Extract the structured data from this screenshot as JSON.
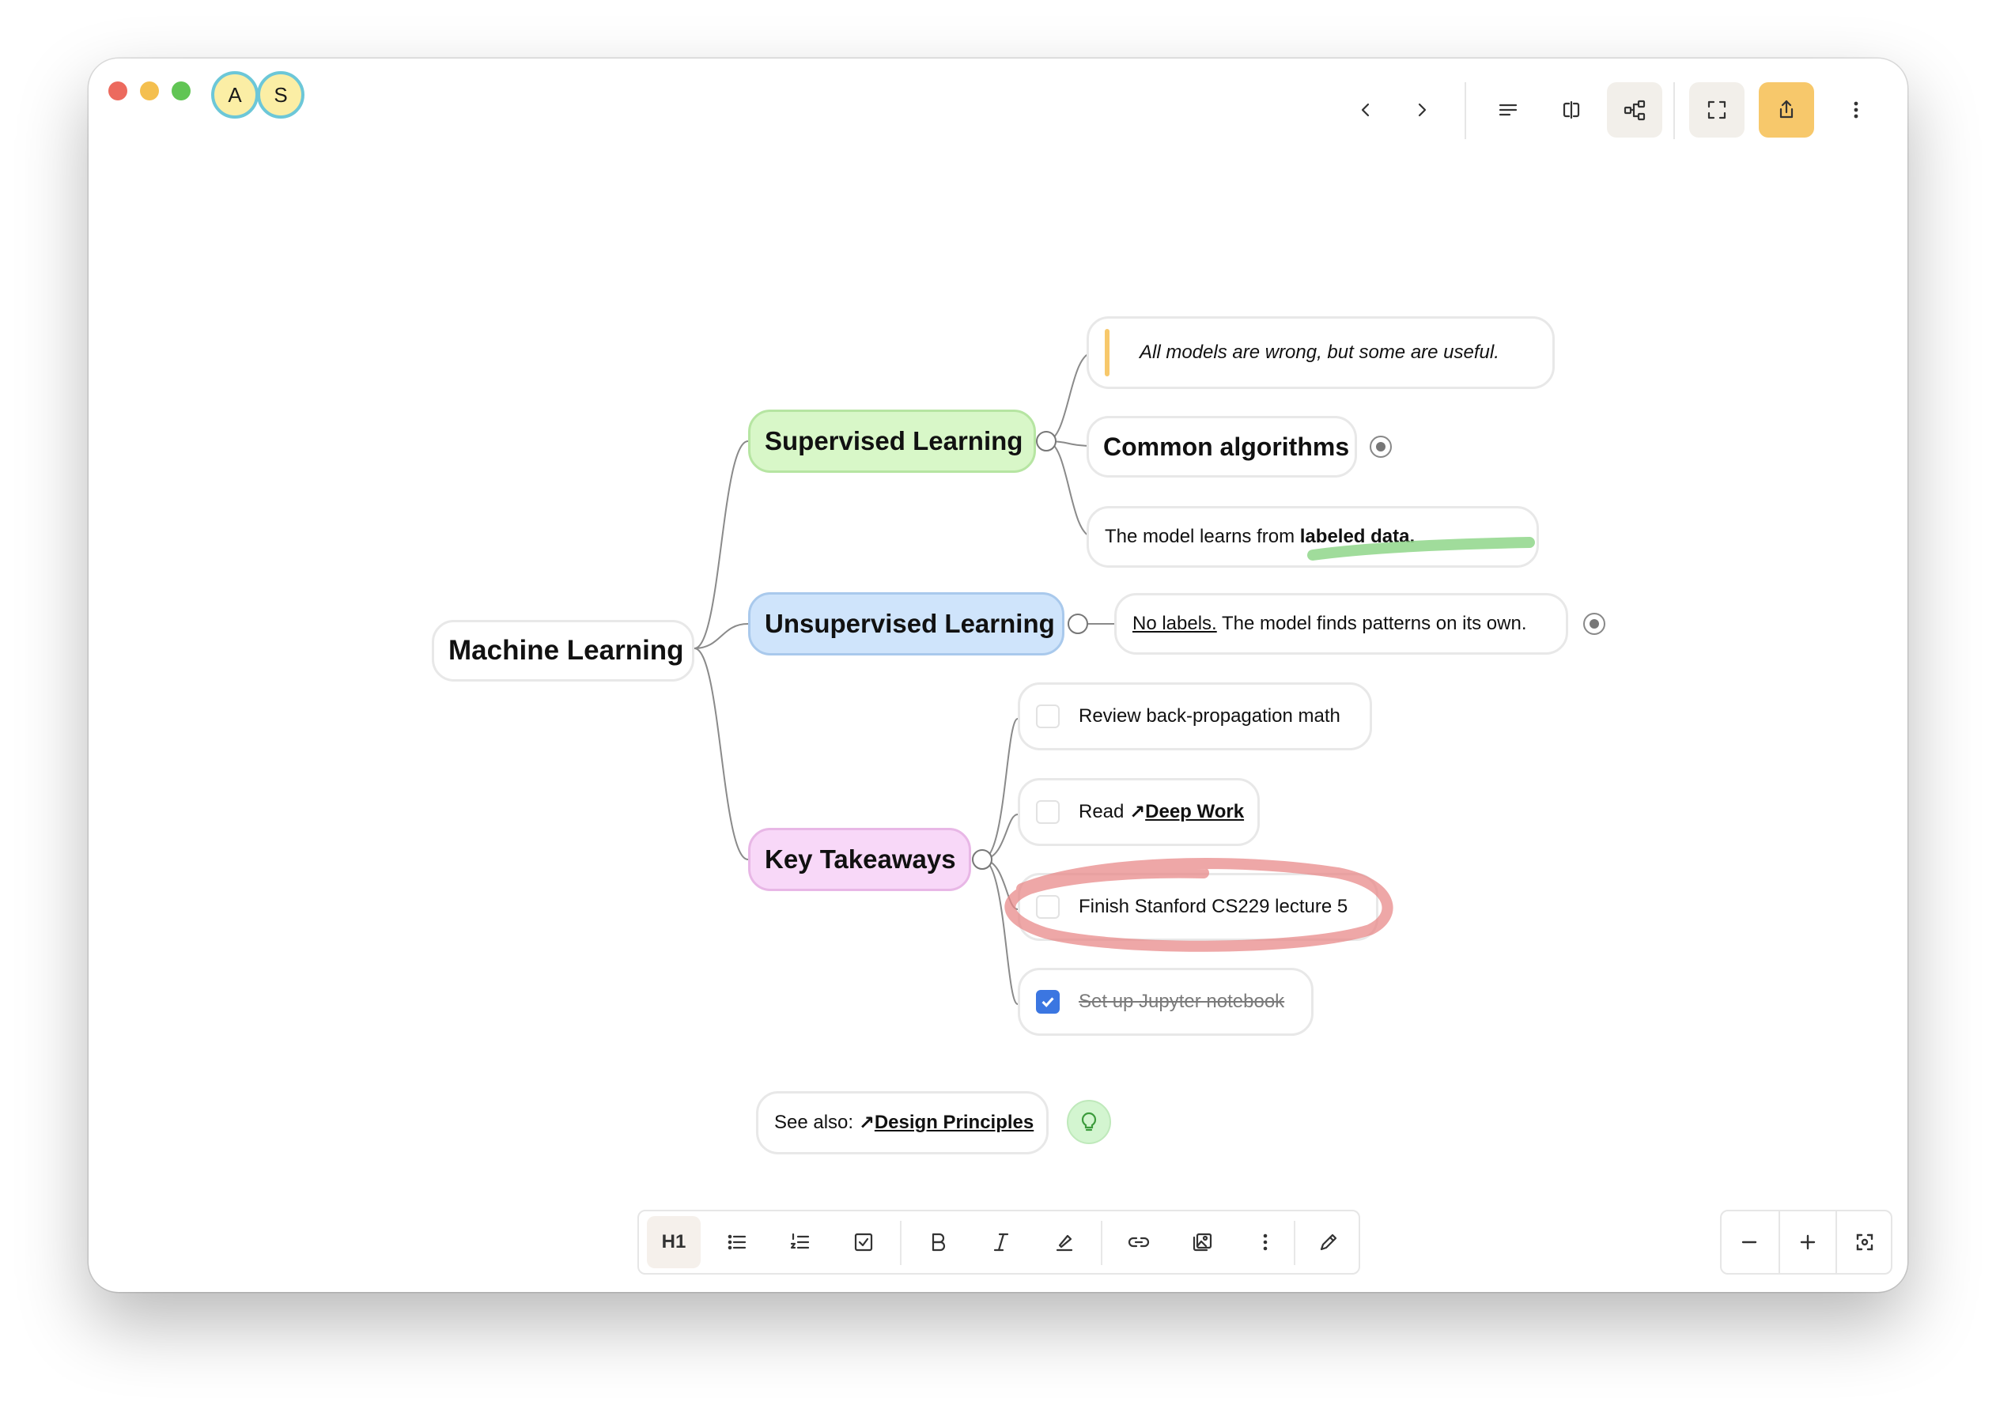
{
  "window": {
    "avatars": [
      "A",
      "S"
    ],
    "toolbar": {
      "back": "chevron-left-icon",
      "forward": "chevron-right-icon",
      "outline": "text-align-icon",
      "split": "split-view-icon",
      "mindmap": "mind-map-icon",
      "fullscreen": "expand-icon",
      "share": "share-icon",
      "more": "more-vertical-icon"
    }
  },
  "mindmap": {
    "root": "Machine Learning",
    "supervised": {
      "label": "Supervised Learning",
      "quote": "All models are wrong, but some are useful.",
      "algorithms": "Common algorithms",
      "desc_prefix": "The model learns from ",
      "desc_bold": "labeled data."
    },
    "unsupervised": {
      "label": "Unsupervised Learning",
      "desc_link": "No labels.",
      "desc_rest": " The model finds patterns on its own."
    },
    "takeaways": {
      "label": "Key Takeaways",
      "tasks": [
        {
          "text": "Review back-propagation math",
          "checked": false
        },
        {
          "prefix": "Read ",
          "link": "Deep Work",
          "checked": false
        },
        {
          "text": "Finish Stanford CS229 lecture 5",
          "checked": false
        },
        {
          "text": "Set up Jupyter notebook",
          "checked": true
        }
      ]
    },
    "see_also": {
      "prefix": "See also: ",
      "link": "Design Principles"
    }
  },
  "format_toolbar": {
    "heading": "H1"
  },
  "colors": {
    "supervised": "#d8f7c8",
    "unsupervised": "#cfe4fb",
    "takeaways": "#f8d8f8",
    "share_button": "#f7c86b",
    "check_blue": "#3b76e1",
    "annotation_red": "#e88a8a",
    "highlight_green": "#8fd68a"
  }
}
